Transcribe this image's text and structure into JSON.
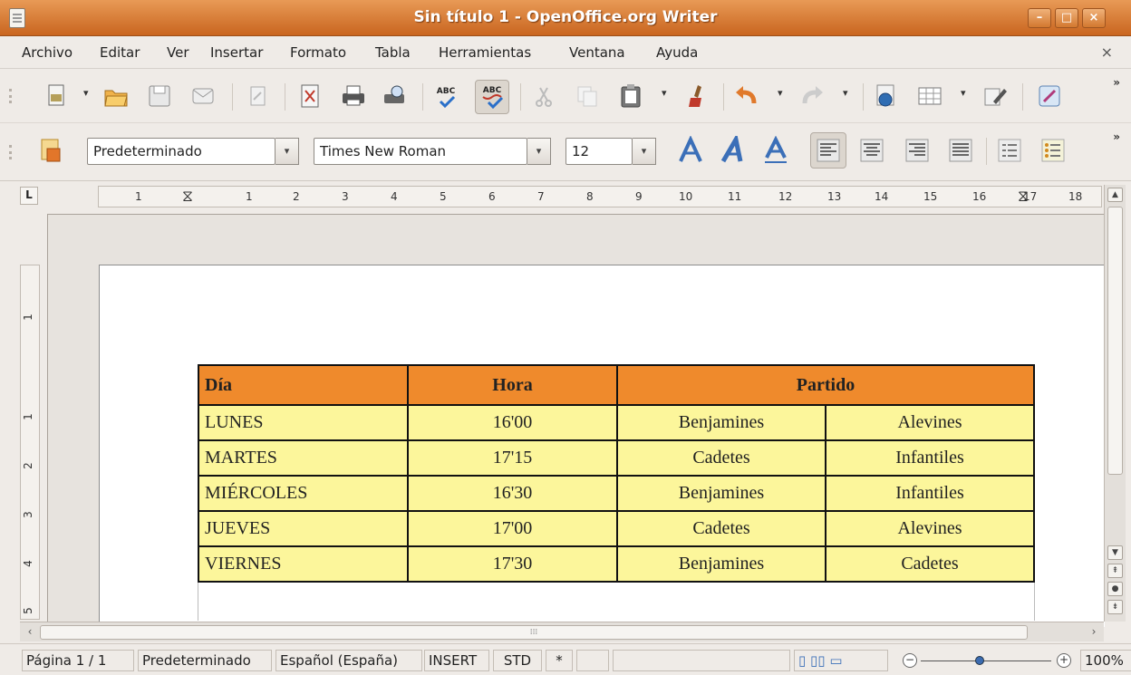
{
  "window": {
    "title": "Sin título 1 - OpenOffice.org Writer",
    "controls": [
      "–",
      "□",
      "×"
    ]
  },
  "menubar": {
    "items": [
      "Archivo",
      "Editar",
      "Ver",
      "Insertar",
      "Formato",
      "Tabla",
      "Herramientas",
      "Ventana",
      "Ayuda"
    ],
    "close": "×"
  },
  "toolbar": {
    "standard_icons": [
      "new-document-icon",
      "open-icon",
      "save-icon",
      "email-icon",
      "edit-file-icon",
      "export-pdf-icon",
      "print-icon",
      "page-preview-icon",
      "spellcheck-icon",
      "autospellcheck-icon",
      "cut-icon",
      "copy-icon",
      "paste-icon",
      "format-paintbrush-icon",
      "undo-icon",
      "redo-icon",
      "navigator-icon",
      "table-icon",
      "draw-functions-icon",
      "help-icon"
    ],
    "paste_label": "",
    "overflow": "»",
    "style_value": "Predeterminado",
    "font_value": "Times New Roman",
    "size_value": "12",
    "spell_label": "ABC"
  },
  "ruler": {
    "horizontal": [
      "1",
      "1",
      "2",
      "3",
      "4",
      "5",
      "6",
      "7",
      "8",
      "9",
      "10",
      "11",
      "12",
      "13",
      "14",
      "15",
      "16",
      "17",
      "18"
    ],
    "vertical": [
      "1",
      "1",
      "2",
      "3",
      "4",
      "5"
    ],
    "corner": "L"
  },
  "table": {
    "header": [
      "Día",
      "Hora",
      "Partido"
    ],
    "rows": [
      [
        "LUNES",
        "16'00",
        "Benjamines",
        "Alevines"
      ],
      [
        "MARTES",
        "17'15",
        "Cadetes",
        "Infantiles"
      ],
      [
        "MIÉRCOLES",
        "16'30",
        "Benjamines",
        "Infantiles"
      ],
      [
        "JUEVES",
        "17'00",
        "Cadetes",
        "Alevines"
      ],
      [
        "VIERNES",
        "17'30",
        "Benjamines",
        "Cadetes"
      ]
    ]
  },
  "statusbar": {
    "page": "Página  1 / 1",
    "page_style": "Predeterminado",
    "language": "Español (España)",
    "insert_mode": "INSERT",
    "selection_mode": "STD",
    "modified": "*",
    "zoom": "100%",
    "zoom_level": 0.45
  },
  "colors": {
    "titlebar": "#d97a34",
    "table_header": "#ef8a2c",
    "table_body": "#fcf69b"
  }
}
